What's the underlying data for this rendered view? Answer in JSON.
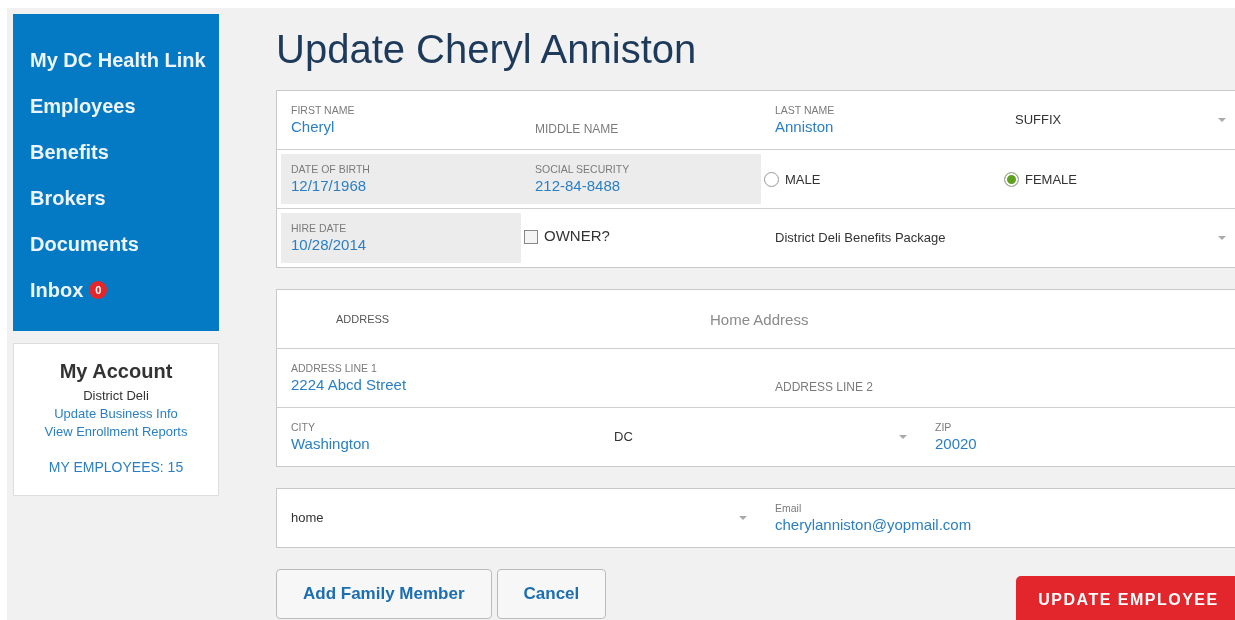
{
  "title": "Update Cheryl Anniston",
  "nav": [
    {
      "label": "My DC Health Link"
    },
    {
      "label": "Employees"
    },
    {
      "label": "Benefits"
    },
    {
      "label": "Brokers"
    },
    {
      "label": "Documents"
    },
    {
      "label": "Inbox",
      "badge": "0"
    }
  ],
  "account": {
    "title": "My Account",
    "company": "District Deli",
    "links": [
      "Update Business Info",
      "View Enrollment Reports"
    ],
    "employees": "MY EMPLOYEES: 15"
  },
  "cards": [
    {
      "rows": [
        {
          "cells": [
            {
              "kind": "field",
              "label": "FIRST NAME",
              "value": "Cheryl",
              "disabled": false
            },
            {
              "kind": "field",
              "placeholder": "MIDDLE NAME",
              "disabled": false
            },
            {
              "kind": "field",
              "label": "LAST NAME",
              "value": "Anniston",
              "disabled": false
            },
            {
              "kind": "select",
              "value": "SUFFIX"
            }
          ]
        },
        {
          "cells": [
            {
              "kind": "field",
              "label": "DATE OF BIRTH",
              "value": "12/17/1968",
              "disabled": true
            },
            {
              "kind": "field",
              "label": "SOCIAL SECURITY",
              "value": "212-84-8488",
              "disabled": true
            },
            {
              "kind": "radio",
              "label": "MALE",
              "selected": false
            },
            {
              "kind": "radio",
              "label": "FEMALE",
              "selected": true
            }
          ]
        },
        {
          "cells": [
            {
              "kind": "field",
              "label": "HIRE DATE",
              "value": "10/28/2014",
              "disabled": true
            },
            {
              "kind": "checkbox",
              "label": "OWNER?",
              "checked": false
            },
            {
              "kind": "select",
              "value": "District Deli Benefits Package"
            }
          ]
        }
      ]
    },
    {
      "rows": [
        {
          "cells": [
            {
              "kind": "heading",
              "label": "ADDRESS"
            },
            {
              "kind": "input",
              "placeholder": "Home Address"
            }
          ]
        },
        {
          "cells": [
            {
              "kind": "field",
              "label": "ADDRESS LINE 1",
              "value": "2224 Abcd Street",
              "disabled": false
            },
            {
              "kind": "field",
              "placeholder": "ADDRESS LINE 2",
              "disabled": false
            }
          ]
        },
        {
          "cells": [
            {
              "kind": "field",
              "label": "CITY",
              "value": "Washington",
              "disabled": false
            },
            {
              "kind": "select",
              "value": "DC"
            },
            {
              "kind": "field",
              "label": "ZIP",
              "value": "20020",
              "disabled": false
            }
          ]
        }
      ]
    },
    {
      "rows": [
        {
          "cells": [
            {
              "kind": "select",
              "value": "home"
            },
            {
              "kind": "field",
              "label": "Email",
              "value": "cherylanniston@yopmail.com",
              "disabled": false
            }
          ]
        }
      ]
    }
  ],
  "buttons": [
    {
      "label": "Add Family Member",
      "kind": "secondary"
    },
    {
      "label": "Cancel",
      "kind": "secondary"
    },
    {
      "label": "UPDATE EMPLOYEE",
      "kind": "primary"
    }
  ]
}
